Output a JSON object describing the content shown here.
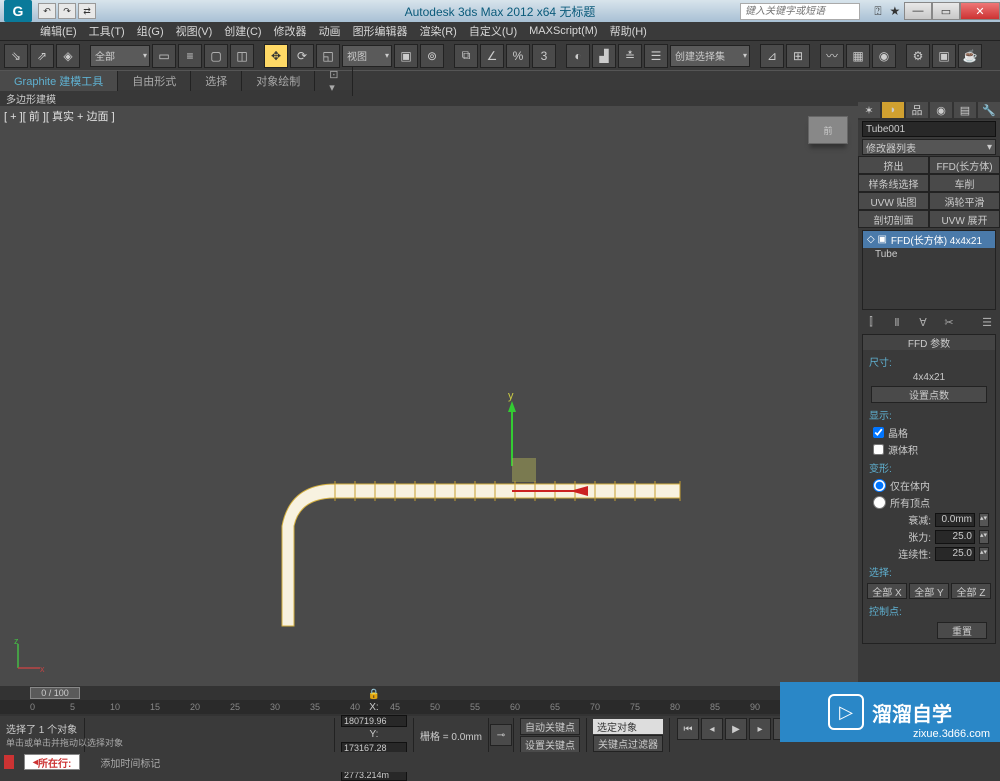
{
  "title": "Autodesk 3ds Max  2012 x64    无标题",
  "search_placeholder": "键入关键字或短语",
  "menu": [
    "编辑(E)",
    "工具(T)",
    "组(G)",
    "视图(V)",
    "创建(C)",
    "修改器",
    "动画",
    "图形编辑器",
    "渲染(R)",
    "自定义(U)",
    "MAXScript(M)",
    "帮助(H)"
  ],
  "toolbar": {
    "layer_drop": "全部",
    "view_drop": "视图",
    "create_sel_drop": "创建选择集"
  },
  "ribbon": {
    "tabs": [
      "Graphite 建模工具",
      "自由形式",
      "选择",
      "对象绘制"
    ],
    "sub": "多边形建模"
  },
  "viewport": {
    "label": "[ + ][ 前 ][ 真实 + 边面 ]",
    "viewcube": "前"
  },
  "panel": {
    "object_name": "Tube001",
    "modifier_list": "修改器列表",
    "buttons": [
      "挤出",
      "FFD(长方体)",
      "样条线选择",
      "车削",
      "UVW 贴图",
      "涡轮平滑",
      "剖切剖面",
      "UVW 展开"
    ],
    "stack": {
      "active": "FFD(长方体) 4x4x21",
      "base": "Tube"
    },
    "sec_title": "FFD 参数",
    "size_label": "尺寸:",
    "size_value": "4x4x21",
    "set_points": "设置点数",
    "show_label": "显示:",
    "chk_lattice": "晶格",
    "chk_source": "源体积",
    "deform_label": "变形:",
    "rad_in": "仅在体内",
    "rad_all": "所有顶点",
    "falloff_label": "衰减:",
    "falloff_val": "0.0mm",
    "tension_label": "张力:",
    "tension_val": "25.0",
    "cont_label": "连续性:",
    "cont_val": "25.0",
    "sel_label": "选择:",
    "sel_btns": [
      "全部 X",
      "全部 Y",
      "全部 Z"
    ],
    "ctrl_label": "控制点:",
    "reset": "重置"
  },
  "timeline": {
    "handle": "0 / 100"
  },
  "status": {
    "sel": "选择了 1 个对象",
    "prompt": "单击或单击并拖动以选择对象",
    "x": "180719.96",
    "y": "173167.28",
    "z": "2773.214m",
    "grid": "栅格 = 0.0mm",
    "autokey": "自动关键点",
    "selkey": "选定对象",
    "setkey": "设置关键点",
    "keyfilter": "关键点过滤器",
    "addtime": "添加时间标记"
  },
  "bottom": {
    "respect": "所在行:"
  },
  "watermark": {
    "main": "溜溜自学",
    "sub": "zixue.3d66.com"
  }
}
